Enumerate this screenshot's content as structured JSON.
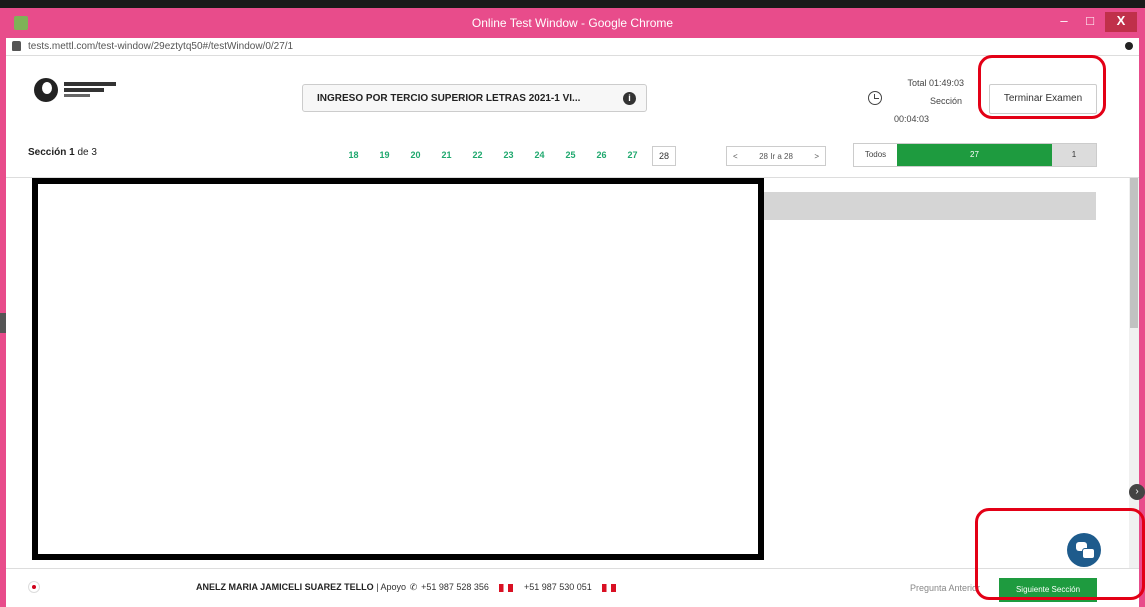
{
  "window": {
    "title": "Online Test Window - Google Chrome",
    "url": "tests.mettl.com/test-window/29eztytq50#/testWindow/0/27/1",
    "min_glyph": "–",
    "max_glyph": "□",
    "close_glyph": "X"
  },
  "header": {
    "exam_title": "INGRESO POR TERCIO SUPERIOR LETRAS 2021-1 VI...",
    "info_glyph": "i",
    "timer_total": "Total 01:49:03",
    "timer_section_label": "Sección",
    "timer_section_value": "00:04:03",
    "end_exam_label": "Terminar Examen"
  },
  "section_bar": {
    "section_word": "Sección",
    "section_current": "1",
    "section_of": "de 3",
    "question_numbers": [
      "18",
      "19",
      "20",
      "21",
      "22",
      "23",
      "24",
      "25",
      "26",
      "27"
    ],
    "current_question": "28",
    "pager_prev": "<",
    "pager_label": "28 Ir a 28",
    "pager_next": ">",
    "filter_all": "Todos",
    "answered_count": "27",
    "unanswered_count": "1"
  },
  "footer": {
    "student_name": "ANELZ MARIA JAMICELI SUAREZ TELLO",
    "support_label": "| Apoyo",
    "phone_glyph": "✆",
    "phone1": "+51 987 528 356",
    "phone2": "+51 987 530 051",
    "prev_question": "Pregunta Anterior",
    "next_section": "Siguiente Sección"
  },
  "colors": {
    "window_frame": "#e84c8b",
    "accent_green": "#1e9b3f",
    "annotation_red": "#e30016",
    "chat_blue": "#1e5b8c"
  }
}
